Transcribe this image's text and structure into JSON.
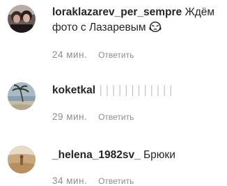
{
  "comments": [
    {
      "username": "loraklazarev_per_sempre",
      "text": "Ждём фото с Лазаревым",
      "emoji": "weary-face-icon",
      "time": "24 мин.",
      "reply_label": "Ответить"
    },
    {
      "username": "koketkal",
      "text": "││││││││││││",
      "time": "29 мин.",
      "reply_label": "Ответить"
    },
    {
      "username": "_helena_1982sv_",
      "text": "Брюки",
      "time": "34 мин.",
      "reply_label": "Ответить"
    }
  ],
  "colors": {
    "username": "#262626",
    "meta": "#8e8e8e",
    "background": "#ffffff"
  }
}
